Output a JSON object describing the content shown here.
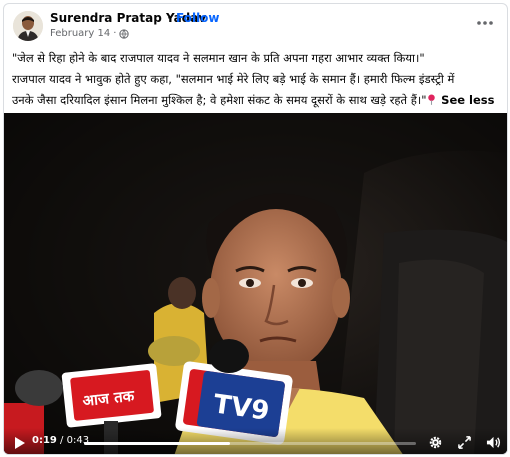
{
  "post": {
    "author": "Surendra Pratap Yadav",
    "separator": "·",
    "follow_label": "Follow",
    "date": "February 14",
    "privacy_icon": "globe-icon",
    "more_icon": "more-horizontal-icon"
  },
  "caption": {
    "line1": "\"जेल से रिहा होने के बाद राजपाल यादव ने सलमान खान के प्रति अपना गहरा आभार व्यक्त किया।\"",
    "line2": "राजपाल यादव ने भावुक होते हुए कहा, \"सलमान भाई मेरे लिए बड़े भाई के समान हैं। हमारी फिल्म इंडस्ट्री में",
    "line3": "उनके जैसा दरियादिल इंसान मिलना मुश्किल है; वे हमेशा संकट के समय दूसरों के साथ खड़े रहते हैं।\"",
    "pin_icon": "round-pushpin-icon",
    "see_less_label": "See less"
  },
  "video": {
    "mic_logos": [
      "आज तक",
      "TV9"
    ],
    "current_time": "0:19",
    "time_separator": " / ",
    "total_time": "0:43",
    "progress_fraction": 0.44,
    "icons": [
      "play-icon",
      "gear-icon",
      "expand-icon",
      "volume-icon"
    ]
  },
  "colors": {
    "link": "#0866ff",
    "secondary_text": "#65676b",
    "mic_red": "#d71920",
    "tv9_blue": "#1c3f94"
  }
}
